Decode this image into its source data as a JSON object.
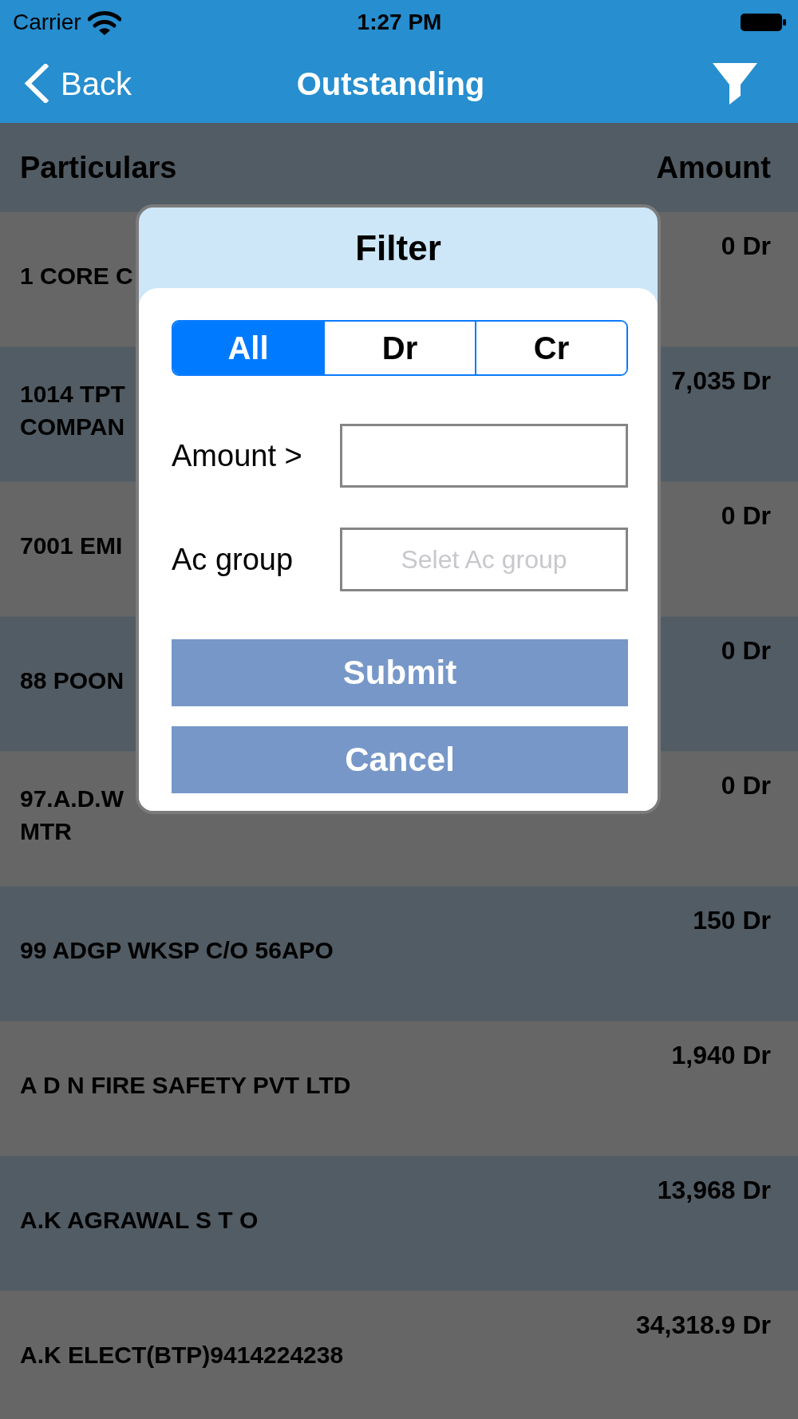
{
  "status_bar": {
    "carrier": "Carrier",
    "time": "1:27 PM"
  },
  "nav_bar": {
    "back_label": "Back",
    "title": "Outstanding"
  },
  "table": {
    "columns": [
      "Particulars",
      "Amount"
    ],
    "rows": [
      {
        "name": "1 CORE C",
        "amount": "0 Dr"
      },
      {
        "name": "1014 TPT\nCOMPAN",
        "amount": "7,035 Dr"
      },
      {
        "name": "7001 EMI",
        "amount": "0 Dr"
      },
      {
        "name": "88 POON",
        "amount": "0 Dr"
      },
      {
        "name": "97.A.D.W\nMTR",
        "amount": "0 Dr"
      },
      {
        "name": "99 ADGP WKSP C/O 56APO",
        "amount": "150 Dr"
      },
      {
        "name": "A D N FIRE SAFETY PVT LTD",
        "amount": "1,940 Dr"
      },
      {
        "name": "A.K AGRAWAL S T O",
        "amount": "13,968 Dr"
      },
      {
        "name": "A.K ELECT(BTP)9414224238",
        "amount": "34,318.9 Dr"
      }
    ]
  },
  "filter_dialog": {
    "title": "Filter",
    "segments": [
      {
        "label": "All",
        "selected": true
      },
      {
        "label": "Dr",
        "selected": false
      },
      {
        "label": "Cr",
        "selected": false
      }
    ],
    "fields": [
      {
        "label": "Amount >"
      },
      {
        "label": "Ac group",
        "placeholder": "Selet Ac group"
      }
    ],
    "buttons": [
      "Submit",
      "Cancel"
    ]
  }
}
